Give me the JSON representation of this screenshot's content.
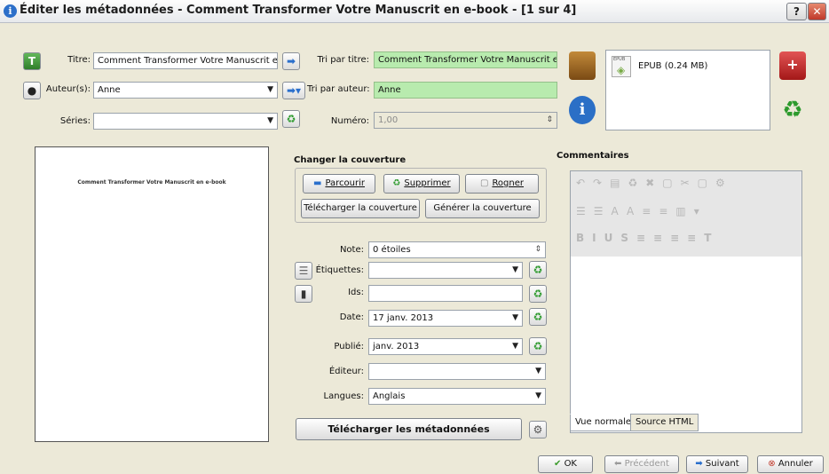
{
  "window": {
    "title": "Éditer les métadonnées - Comment Transformer Votre Manuscrit en e-book - [1 sur 4]",
    "help": "?",
    "close": "✕"
  },
  "fields": {
    "title_label": "Titre:",
    "title_value": "Comment Transformer Votre Manuscrit en e-book",
    "title_sort_label": "Tri par titre:",
    "title_sort_value": "Comment Transformer Votre Manuscrit en e-book",
    "authors_label": "Auteur(s):",
    "authors_value": "Anne",
    "author_sort_label": "Tri par auteur:",
    "author_sort_value": "Anne",
    "series_label": "Séries:",
    "series_value": "",
    "number_label": "Numéro:",
    "number_value": "1,00"
  },
  "format": {
    "name": "EPUB (0.24 MB)",
    "icon_text": "EPUB"
  },
  "cover": {
    "preview_title": "Comment Transformer Votre Manuscrit en e-book",
    "section_title": "Changer la couverture",
    "browse": "Parcourir",
    "remove": "Supprimer",
    "trim": "Rogner",
    "download": "Télécharger la couverture",
    "generate": "Générer la couverture"
  },
  "meta": {
    "rating_label": "Note:",
    "rating_value": "0 étoiles",
    "tags_label": "Étiquettes:",
    "tags_value": "",
    "ids_label": "Ids:",
    "ids_value": "",
    "date_label": "Date:",
    "date_value": "17 janv. 2013",
    "published_label": "Publié:",
    "published_value": "janv. 2013",
    "publisher_label": "Éditeur:",
    "publisher_value": "",
    "languages_label": "Langues:",
    "languages_value": "Anglais",
    "download_meta": "Télécharger les métadonnées"
  },
  "comments": {
    "title": "Commentaires",
    "tab_normal": "Vue normale",
    "tab_html": "Source HTML"
  },
  "footer": {
    "ok": "OK",
    "previous": "Précédent",
    "next": "Suivant",
    "cancel": "Annuler"
  }
}
